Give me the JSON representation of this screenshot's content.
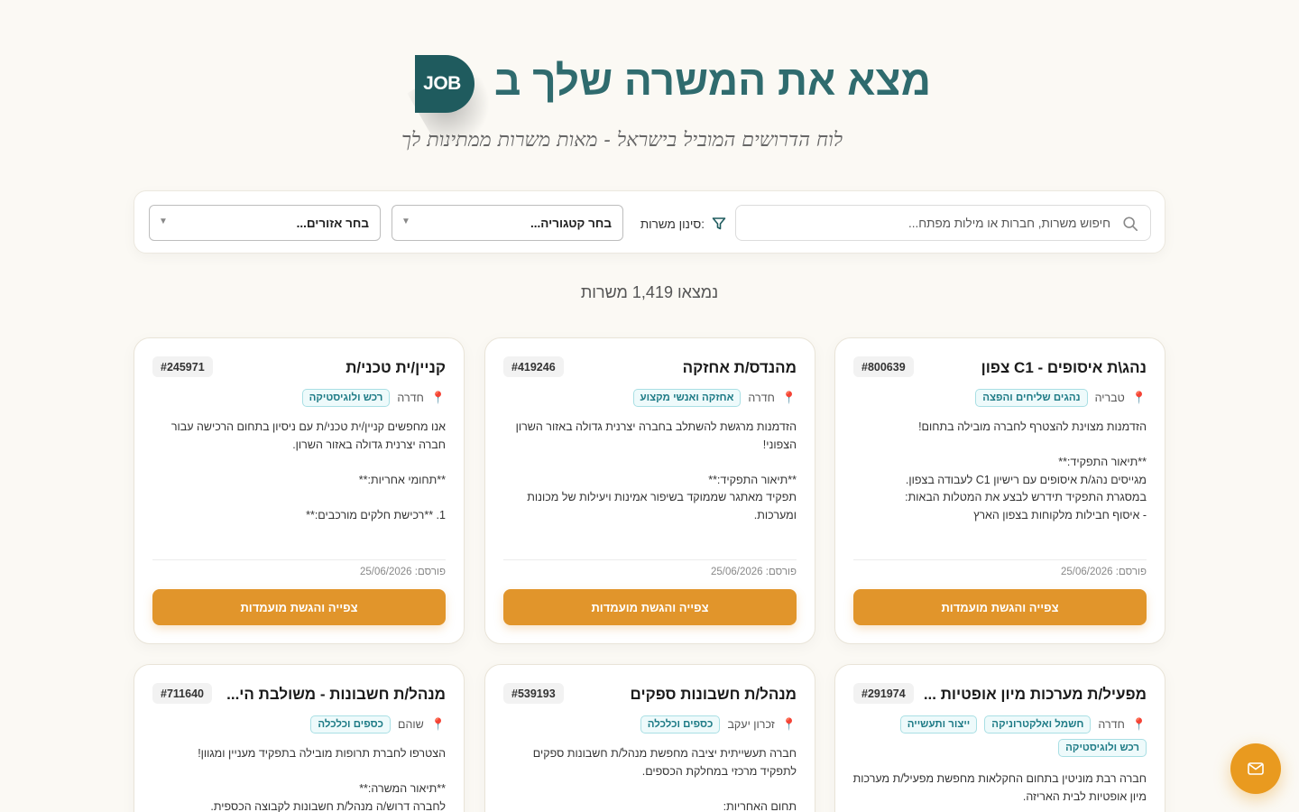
{
  "header": {
    "logo_text": "JOB",
    "title": "מצא את המשרה שלך ב",
    "subtitle": "לוח הדרושים המוביל בישראל - מאות משרות ממתינות לך"
  },
  "filters": {
    "search_placeholder": "חיפוש משרות, חברות או מילות מפתח...",
    "filter_label": "סינון משרות:",
    "category_value": "בחר קטגוריה...",
    "area_value": "בחר אזורים..."
  },
  "results": {
    "count_text": "נמצאו 1,419 משרות"
  },
  "accent_color": "#e1952b",
  "brand_color": "#1f5b5e",
  "cards": [
    {
      "title": "נהג\\ת איסופים - C1 צפון",
      "id": "#800639",
      "location": "טבריה",
      "tags": [
        "נהגים שליחים והפצה"
      ],
      "description": "הזדמנות מצוינת להצטרף לחברה מובילה בתחום!\n\n**תיאור התפקיד:**\nמגייסים נהג/ת איסופים עם רישיון C1 לעבודה בצפון.\nבמסגרת התפקיד תידרש לבצע את המטלות הבאות:\n- איסוף חבילות מלקוחות בצפון הארץ\n- נסיעה למרכז לפריקה ואיסוף חבילות נוספות",
      "date": "פורסם: 25/06/2026",
      "button": "צפייה והגשת מועמדות"
    },
    {
      "title": "מהנדס/ת אחזקה",
      "id": "#419246",
      "location": "חדרה",
      "tags": [
        "אחזקה ואנשי מקצוע"
      ],
      "description": "הזדמנות מרגשת להשתלב בחברה יצרנית גדולה באזור השרון הצפוני!\n\n**תיאור התפקיד:**\nתפקיד מאתגר שממוקד בשיפור אמינות ויעילות של מכונות ומערכות.",
      "date": "פורסם: 25/06/2026",
      "button": "צפייה והגשת מועמדות"
    },
    {
      "title": "קניין/ית טכני/ת",
      "id": "#245971",
      "location": "חדרה",
      "tags": [
        "רכש ולוגיסטיקה"
      ],
      "description": "אנו מחפשים קניין/ית טכני/ת עם ניסיון בתחום הרכישה עבור חברה יצרנית גדולה באזור השרון.\n\n**תחומי אחריות:**\n\n1. **רכישת חלקים מורכבים:**\n- רכש של חלקי חילוף למכונות ציוד כגון גלילים, להבי דוקטור",
      "date": "פורסם: 25/06/2026",
      "button": "צפייה והגשת מועמדות"
    },
    {
      "title": "מפעיל/ת מערכות מיון אופטיות ...",
      "id": "#291974",
      "location": "חדרה",
      "tags": [
        "חשמל ואלקטרוניקה",
        "ייצור ותעשייה",
        "רכש ולוגיסטיקה"
      ],
      "description": "חברה רבת מוניטין בתחום החקלאות מחפשת מפעיל/ת מערכות מיון אופטיות לבית האריזה.",
      "date": "",
      "button": ""
    },
    {
      "title": "מנהל/ת חשבונות ספקים",
      "id": "#539193",
      "location": "זכרון יעקב",
      "tags": [
        "כספים וכלכלה"
      ],
      "description": "חברה תעשייתית יציבה מחפשת מנהל/ת חשבונות ספקים לתפקיד מרכזי במחלקת הכספים.\n\nתחום האחריות:",
      "date": "",
      "button": ""
    },
    {
      "title": "מנהל/ת חשבונות - משולבת הי...",
      "id": "#711640",
      "location": "שוהם",
      "tags": [
        "כספים וכלכלה"
      ],
      "description": "הצטרפו לחברת תרופות מובילה בתפקיד מעניין ומגוון!\n\n**תיאור המשרה:**\nלחברה דרוש/ה מנהל/ת חשבונות לקבוצה הכספית.",
      "date": "",
      "button": ""
    }
  ]
}
